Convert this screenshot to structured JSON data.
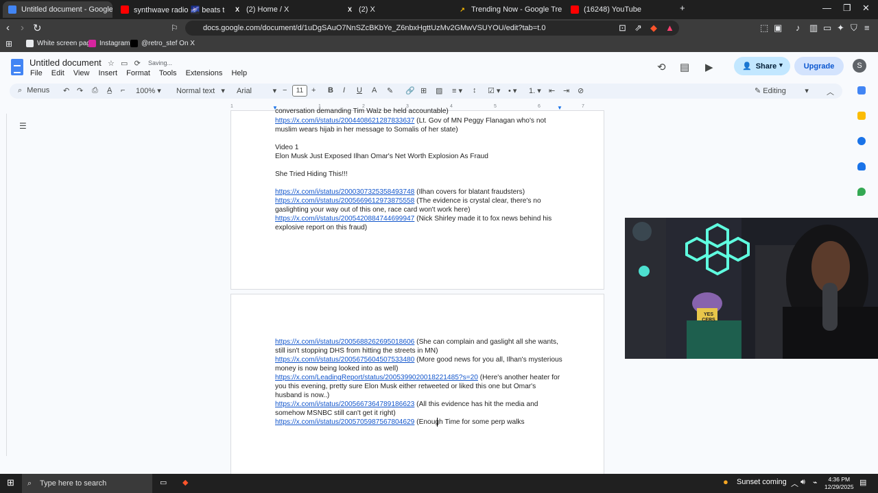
{
  "browser": {
    "tabs": [
      {
        "label": "Untitled document - Google Do",
        "active": true,
        "favicon": "docs-icon"
      },
      {
        "label": "synthwave radio 🌌 beats to chill",
        "active": false,
        "favicon": "youtube-icon"
      },
      {
        "label": "(2) Home / X",
        "active": false,
        "favicon": "x-icon"
      },
      {
        "label": "(2) X",
        "active": false,
        "favicon": "x-icon"
      },
      {
        "label": "Trending Now - Google Trends",
        "active": false,
        "favicon": "trends-icon"
      },
      {
        "label": "(16248) YouTube",
        "active": false,
        "favicon": "youtube-icon"
      }
    ],
    "url": "docs.google.com/document/d/1uDgSAuO7NnSZcBKbYe_Z6nbxHgttUzMv2GMwVSUYOU/edit?tab=t.0",
    "bookmarks": [
      {
        "label": "White screen page",
        "icon": "page-icon"
      },
      {
        "label": "Instagram",
        "icon": "instagram-icon"
      },
      {
        "label": "@retro_stef On X",
        "icon": "x-icon"
      }
    ]
  },
  "doc": {
    "title": "Untitled document",
    "status": "Saving...",
    "menus": [
      "File",
      "Edit",
      "View",
      "Insert",
      "Format",
      "Tools",
      "Extensions",
      "Help"
    ],
    "share_label": "Share",
    "upgrade_label": "Upgrade",
    "avatar_letter": "S",
    "toolbar": {
      "menus_label": "Menus",
      "zoom": "100%",
      "style": "Normal text",
      "font": "Arial",
      "font_size": "11",
      "mode": "Editing"
    },
    "ruler_ticks": [
      "1",
      "1",
      "2",
      "3",
      "4",
      "5",
      "6",
      "7"
    ]
  },
  "page1": [
    {
      "text": "conversation demanding Tim Walz be held accountable)"
    },
    {
      "link": "https://x.com/i/status/2004408621287833637",
      "text": " (Lt. Gov of MN Peggy Flanagan who's not muslim wears hijab in her message to Somalis of her state)"
    },
    {
      "text": "Video 1"
    },
    {
      "text": "Elon Musk Just Exposed Ilhan Omar's Net Worth Explosion As Fraud"
    },
    {
      "text": "She Tried Hiding This!!!"
    },
    {
      "link": "https://x.com/i/status/2000307325358493748",
      "text": " (Ilhan covers for blatant fraudsters)"
    },
    {
      "link": "https://x.com/i/status/2005669612973875558",
      "text": " (The evidence is crystal clear, there's no gaslighting your way out of this one, race card won't work here)"
    },
    {
      "link": "https://x.com/i/status/2005420884744699947",
      "text": " (Nick Shirley made it to fox news behind his explosive report on this fraud)"
    }
  ],
  "page2": [
    {
      "link": "https://x.com/i/status/2005688262695018606",
      "text": " (She can complain and gaslight all she wants, still isn't stopping DHS from hitting the streets in MN)"
    },
    {
      "link": "https://x.com/i/status/2005675604507533480",
      "text": " (More good news for you all, Ilhan's mysterious money is now being looked into as well)"
    },
    {
      "link": "https://x.com/LeadingReport/status/2005399020018221485?s=20",
      "text": " (Here's another heater for you this evening, pretty sure Elon Musk either retweeted or liked this one but Omar's husband is now..)"
    },
    {
      "link": "https://x.com/i/status/2005667364789186623",
      "text": " (All this evidence has hit the media and somehow MSNBC still can't get it right)"
    },
    {
      "link": "https://x.com/i/status/2005705987567804629",
      "text": " (Enough Time for some perp walks"
    }
  ],
  "webcam": {
    "sign_text": "YES CERS"
  },
  "taskbar": {
    "search_placeholder": "Type here to search",
    "weather": "Sunset coming",
    "time": "4:36 PM",
    "date": "12/29/2025"
  },
  "colors": {
    "accent": "#1a73e8",
    "link": "#1155cc",
    "share_bg": "#c2e7ff"
  }
}
